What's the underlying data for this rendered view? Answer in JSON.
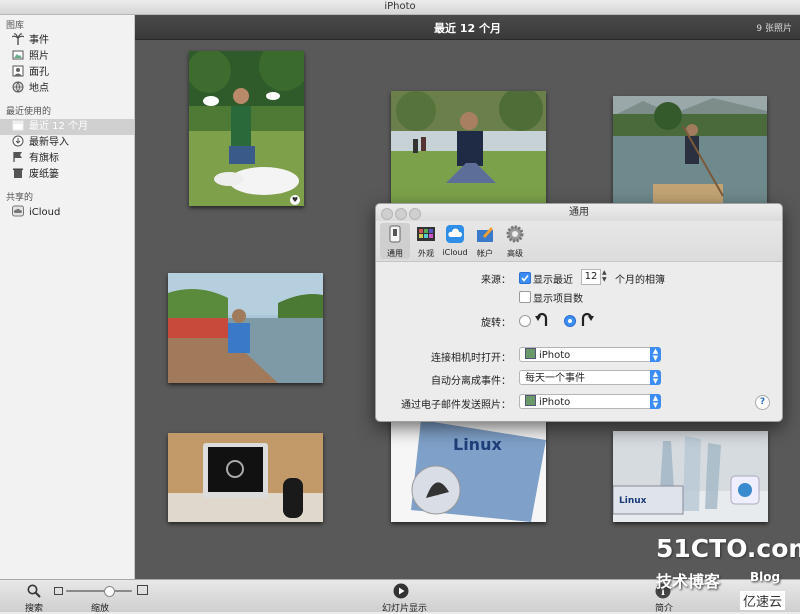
{
  "window": {
    "title": "iPhoto"
  },
  "sidebar": {
    "sections": [
      {
        "header": "图库",
        "items": [
          {
            "label": "事件",
            "icon": "palm-tree-icon"
          },
          {
            "label": "照片",
            "icon": "photos-icon"
          },
          {
            "label": "面孔",
            "icon": "face-icon"
          },
          {
            "label": "地点",
            "icon": "globe-icon"
          }
        ]
      },
      {
        "header": "最近使用的",
        "items": [
          {
            "label": "最近 12 个月",
            "icon": "calendar-icon",
            "selected": true
          },
          {
            "label": "最新导入",
            "icon": "import-icon"
          },
          {
            "label": "有旗标",
            "icon": "flag-icon"
          },
          {
            "label": "废纸篓",
            "icon": "trash-icon"
          }
        ]
      },
      {
        "header": "共享的",
        "items": [
          {
            "label": "iCloud",
            "icon": "cloud-icon"
          }
        ]
      }
    ]
  },
  "header": {
    "title": "最近 12 个月",
    "count": "9 张照片"
  },
  "toolbar": {
    "search_label": "搜索",
    "zoom_label": "缩放",
    "zoom_level": 0.65,
    "slideshow_label": "幻灯片显示",
    "info_label": "简介"
  },
  "dialog": {
    "title": "通用",
    "tabs": [
      {
        "label": "通用",
        "icon": "switch-icon",
        "active": true
      },
      {
        "label": "外观",
        "icon": "appearance-icon"
      },
      {
        "label": "iCloud",
        "icon": "cloud-icon"
      },
      {
        "label": "帐户",
        "icon": "accounts-icon"
      },
      {
        "label": "高级",
        "icon": "gear-icon"
      }
    ],
    "source_label": "来源：",
    "show_recent_label": "显示最近",
    "show_recent_checked": true,
    "months_value": "12",
    "months_suffix": "个月的相簿",
    "show_count_label": "显示项目数",
    "show_count_checked": false,
    "rotate_label": "旋转：",
    "rotate_selected": "clockwise",
    "connect_label": "连接相机时打开：",
    "connect_value": "iPhoto",
    "autosplit_label": "自动分离成事件：",
    "autosplit_value": "每天一个事件",
    "email_label": "通过电子邮件发送照片：",
    "email_value": "iPhoto",
    "help": "?"
  },
  "photos": [
    {
      "caption": ""
    }
  ],
  "watermark": {
    "main": "51CTO.com",
    "sub": "技术博客",
    "blog": "Blog",
    "badge": "亿速云"
  }
}
